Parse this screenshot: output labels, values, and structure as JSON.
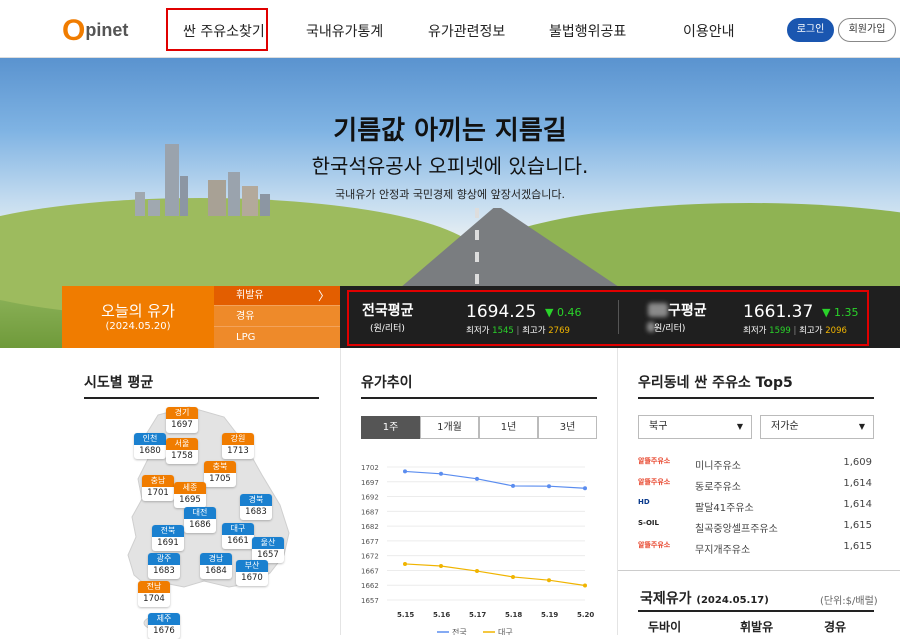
{
  "header": {
    "logo": {
      "o": "O",
      "rest": "pinet"
    },
    "nav": [
      "싼 주유소찾기",
      "국내유가통계",
      "유가관련정보",
      "불법행위공표",
      "이용안내"
    ],
    "login_label": "로그인",
    "join_label": "회원가입"
  },
  "hero": {
    "title": "기름값 아끼는 지름길",
    "subtitle": "한국석유공사 오피넷에 있습니다.",
    "desc": "국내유가 안정과 국민경제 향상에 앞장서겠습니다."
  },
  "today": {
    "title": "오늘의 유가",
    "date": "(2024.05.20)",
    "tabs": [
      "휘발유",
      "경유",
      "LPG"
    ],
    "tab_arrow": "〉"
  },
  "national": {
    "label": "전국평균",
    "unit": "(원/리터)",
    "price": "1694.25",
    "change": "▼ 0.46",
    "min_label": "최저가",
    "min": "1545",
    "max_label": "최고가",
    "max": "2769",
    "divider": "|"
  },
  "regional": {
    "label_visible": "구평균",
    "unit_visible": "원/리터)",
    "price": "1661.37",
    "change": "▼ 1.35",
    "min_label": "최저가",
    "min": "1599",
    "max_label": "최고가",
    "max": "2096",
    "divider": "|"
  },
  "sido": {
    "title": "시도별 평균",
    "markers": [
      {
        "name": "경기",
        "value": "1697",
        "color": "orange"
      },
      {
        "name": "인천",
        "value": "1680",
        "color": "blue"
      },
      {
        "name": "서울",
        "value": "1758",
        "color": "orange"
      },
      {
        "name": "강원",
        "value": "1713",
        "color": "orange"
      },
      {
        "name": "충북",
        "value": "1705",
        "color": "orange"
      },
      {
        "name": "충남",
        "value": "1701",
        "color": "orange"
      },
      {
        "name": "세종",
        "value": "1695",
        "color": "orange"
      },
      {
        "name": "경북",
        "value": "1683",
        "color": "blue"
      },
      {
        "name": "대전",
        "value": "1686",
        "color": "blue"
      },
      {
        "name": "전북",
        "value": "1691",
        "color": "blue"
      },
      {
        "name": "대구",
        "value": "1661",
        "color": "blue"
      },
      {
        "name": "울산",
        "value": "1657",
        "color": "blue"
      },
      {
        "name": "광주",
        "value": "1683",
        "color": "blue"
      },
      {
        "name": "경남",
        "value": "1684",
        "color": "blue"
      },
      {
        "name": "부산",
        "value": "1670",
        "color": "blue"
      },
      {
        "name": "전남",
        "value": "1704",
        "color": "orange"
      },
      {
        "name": "제주",
        "value": "1676",
        "color": "blue"
      }
    ]
  },
  "trend": {
    "title": "유가추이",
    "tabs": [
      "1주",
      "1개월",
      "1년",
      "3년"
    ],
    "legend_visible": [
      "전국",
      "대구"
    ]
  },
  "chart_data": {
    "type": "line",
    "x": [
      "5.15",
      "5.16",
      "5.17",
      "5.18",
      "5.19",
      "5.20"
    ],
    "yticks": [
      1702,
      1697,
      1692,
      1687,
      1682,
      1677,
      1672,
      1667,
      1662,
      1657
    ],
    "ylim": [
      1657,
      1702
    ],
    "series": [
      {
        "name": "전국",
        "color": "#5b8def",
        "values": [
          1700.5,
          1699.7,
          1698.0,
          1695.6,
          1695.5,
          1694.8
        ]
      },
      {
        "name": "대구",
        "color": "#f0b400",
        "values": [
          1669.2,
          1668.5,
          1666.8,
          1664.8,
          1663.7,
          1661.9
        ]
      }
    ]
  },
  "top5": {
    "title": "우리동네 싼 주유소 Top5",
    "region": "북구",
    "sort": "저가순",
    "stations": [
      {
        "brand": "알뜰주유소",
        "name": "미니주유소",
        "price": "1,609",
        "logo_color": "#e8452c"
      },
      {
        "brand": "알뜰주유소",
        "name": "동로주유소",
        "price": "1,614",
        "logo_color": "#e8452c"
      },
      {
        "brand": "HD",
        "name": "팔달41주유소",
        "price": "1,614",
        "logo_color": "#0a3a8c"
      },
      {
        "brand": "S-OIL",
        "name": "칠곡중앙셀프주유소",
        "price": "1,615",
        "logo_color": "#222"
      },
      {
        "brand": "알뜰주유소",
        "name": "무지개주유소",
        "price": "1,615",
        "logo_color": "#e8452c"
      }
    ]
  },
  "intl": {
    "title": "국제유가",
    "date": "(2024.05.17)",
    "unit": "(단위:$/배럴)",
    "cols": [
      "두바이",
      "휘발유",
      "경유"
    ]
  }
}
